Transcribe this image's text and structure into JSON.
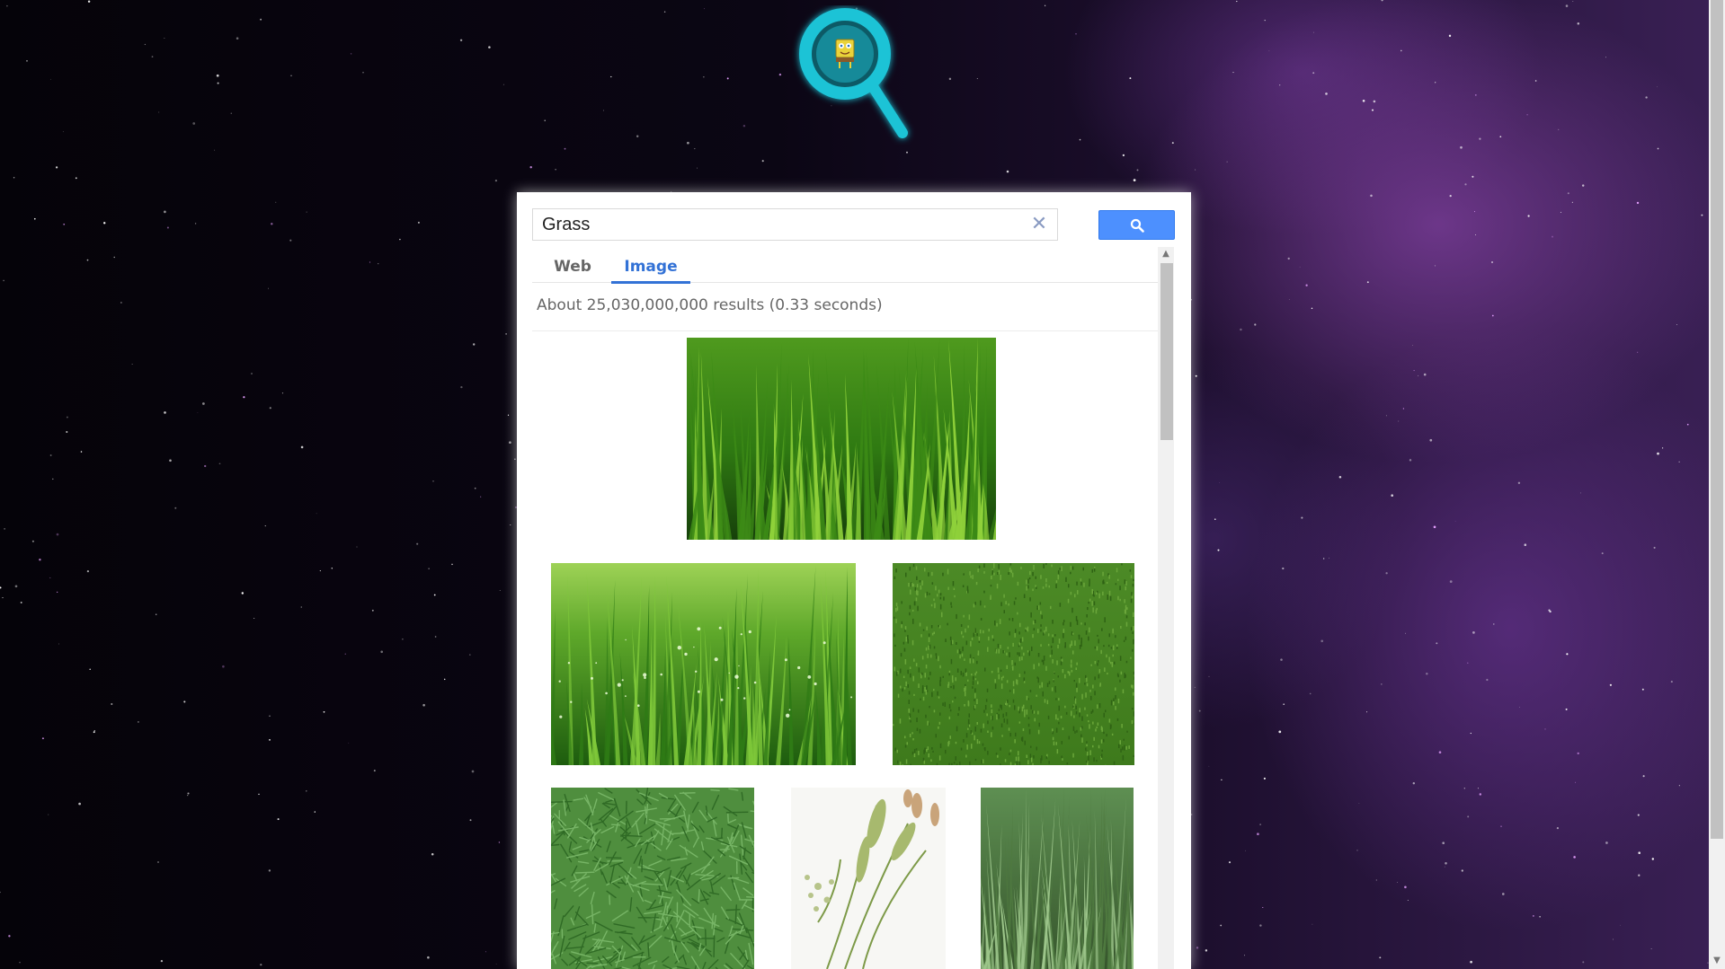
{
  "search": {
    "query": "Grass",
    "clear_icon": "close-icon",
    "button_icon": "search-icon"
  },
  "tabs": [
    {
      "label": "Web",
      "active": false
    },
    {
      "label": "Image",
      "active": true
    }
  ],
  "results": {
    "info": "About 25,030,000,000 results (0.33 seconds)"
  },
  "thumbnails": [
    {
      "subject": "grass blades close-up"
    },
    {
      "subject": "dewy grass blades"
    },
    {
      "subject": "lawn"
    },
    {
      "subject": "grass texture"
    },
    {
      "subject": "grass seed heads"
    },
    {
      "subject": "grass tuft"
    }
  ],
  "colors": {
    "accent": "#3372d6",
    "search_button": "#4d90fe",
    "logo": "#1fc3d6"
  }
}
